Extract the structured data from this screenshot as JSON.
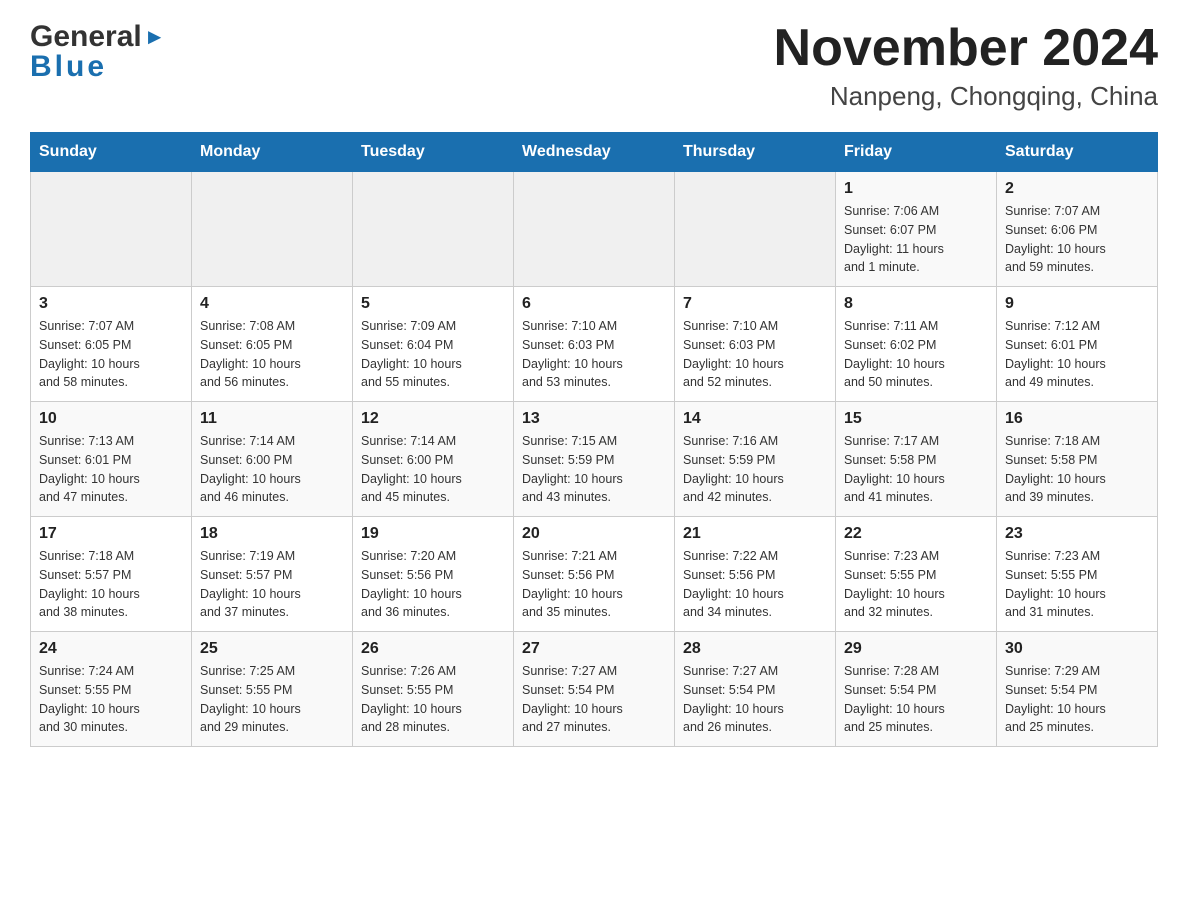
{
  "header": {
    "logo_line1": "General",
    "logo_line2": "Blue",
    "month_title": "November 2024",
    "location": "Nanpeng, Chongqing, China"
  },
  "days_of_week": [
    "Sunday",
    "Monday",
    "Tuesday",
    "Wednesday",
    "Thursday",
    "Friday",
    "Saturday"
  ],
  "weeks": [
    {
      "days": [
        {
          "num": "",
          "info": ""
        },
        {
          "num": "",
          "info": ""
        },
        {
          "num": "",
          "info": ""
        },
        {
          "num": "",
          "info": ""
        },
        {
          "num": "",
          "info": ""
        },
        {
          "num": "1",
          "info": "Sunrise: 7:06 AM\nSunset: 6:07 PM\nDaylight: 11 hours\nand 1 minute."
        },
        {
          "num": "2",
          "info": "Sunrise: 7:07 AM\nSunset: 6:06 PM\nDaylight: 10 hours\nand 59 minutes."
        }
      ]
    },
    {
      "days": [
        {
          "num": "3",
          "info": "Sunrise: 7:07 AM\nSunset: 6:05 PM\nDaylight: 10 hours\nand 58 minutes."
        },
        {
          "num": "4",
          "info": "Sunrise: 7:08 AM\nSunset: 6:05 PM\nDaylight: 10 hours\nand 56 minutes."
        },
        {
          "num": "5",
          "info": "Sunrise: 7:09 AM\nSunset: 6:04 PM\nDaylight: 10 hours\nand 55 minutes."
        },
        {
          "num": "6",
          "info": "Sunrise: 7:10 AM\nSunset: 6:03 PM\nDaylight: 10 hours\nand 53 minutes."
        },
        {
          "num": "7",
          "info": "Sunrise: 7:10 AM\nSunset: 6:03 PM\nDaylight: 10 hours\nand 52 minutes."
        },
        {
          "num": "8",
          "info": "Sunrise: 7:11 AM\nSunset: 6:02 PM\nDaylight: 10 hours\nand 50 minutes."
        },
        {
          "num": "9",
          "info": "Sunrise: 7:12 AM\nSunset: 6:01 PM\nDaylight: 10 hours\nand 49 minutes."
        }
      ]
    },
    {
      "days": [
        {
          "num": "10",
          "info": "Sunrise: 7:13 AM\nSunset: 6:01 PM\nDaylight: 10 hours\nand 47 minutes."
        },
        {
          "num": "11",
          "info": "Sunrise: 7:14 AM\nSunset: 6:00 PM\nDaylight: 10 hours\nand 46 minutes."
        },
        {
          "num": "12",
          "info": "Sunrise: 7:14 AM\nSunset: 6:00 PM\nDaylight: 10 hours\nand 45 minutes."
        },
        {
          "num": "13",
          "info": "Sunrise: 7:15 AM\nSunset: 5:59 PM\nDaylight: 10 hours\nand 43 minutes."
        },
        {
          "num": "14",
          "info": "Sunrise: 7:16 AM\nSunset: 5:59 PM\nDaylight: 10 hours\nand 42 minutes."
        },
        {
          "num": "15",
          "info": "Sunrise: 7:17 AM\nSunset: 5:58 PM\nDaylight: 10 hours\nand 41 minutes."
        },
        {
          "num": "16",
          "info": "Sunrise: 7:18 AM\nSunset: 5:58 PM\nDaylight: 10 hours\nand 39 minutes."
        }
      ]
    },
    {
      "days": [
        {
          "num": "17",
          "info": "Sunrise: 7:18 AM\nSunset: 5:57 PM\nDaylight: 10 hours\nand 38 minutes."
        },
        {
          "num": "18",
          "info": "Sunrise: 7:19 AM\nSunset: 5:57 PM\nDaylight: 10 hours\nand 37 minutes."
        },
        {
          "num": "19",
          "info": "Sunrise: 7:20 AM\nSunset: 5:56 PM\nDaylight: 10 hours\nand 36 minutes."
        },
        {
          "num": "20",
          "info": "Sunrise: 7:21 AM\nSunset: 5:56 PM\nDaylight: 10 hours\nand 35 minutes."
        },
        {
          "num": "21",
          "info": "Sunrise: 7:22 AM\nSunset: 5:56 PM\nDaylight: 10 hours\nand 34 minutes."
        },
        {
          "num": "22",
          "info": "Sunrise: 7:23 AM\nSunset: 5:55 PM\nDaylight: 10 hours\nand 32 minutes."
        },
        {
          "num": "23",
          "info": "Sunrise: 7:23 AM\nSunset: 5:55 PM\nDaylight: 10 hours\nand 31 minutes."
        }
      ]
    },
    {
      "days": [
        {
          "num": "24",
          "info": "Sunrise: 7:24 AM\nSunset: 5:55 PM\nDaylight: 10 hours\nand 30 minutes."
        },
        {
          "num": "25",
          "info": "Sunrise: 7:25 AM\nSunset: 5:55 PM\nDaylight: 10 hours\nand 29 minutes."
        },
        {
          "num": "26",
          "info": "Sunrise: 7:26 AM\nSunset: 5:55 PM\nDaylight: 10 hours\nand 28 minutes."
        },
        {
          "num": "27",
          "info": "Sunrise: 7:27 AM\nSunset: 5:54 PM\nDaylight: 10 hours\nand 27 minutes."
        },
        {
          "num": "28",
          "info": "Sunrise: 7:27 AM\nSunset: 5:54 PM\nDaylight: 10 hours\nand 26 minutes."
        },
        {
          "num": "29",
          "info": "Sunrise: 7:28 AM\nSunset: 5:54 PM\nDaylight: 10 hours\nand 25 minutes."
        },
        {
          "num": "30",
          "info": "Sunrise: 7:29 AM\nSunset: 5:54 PM\nDaylight: 10 hours\nand 25 minutes."
        }
      ]
    }
  ]
}
